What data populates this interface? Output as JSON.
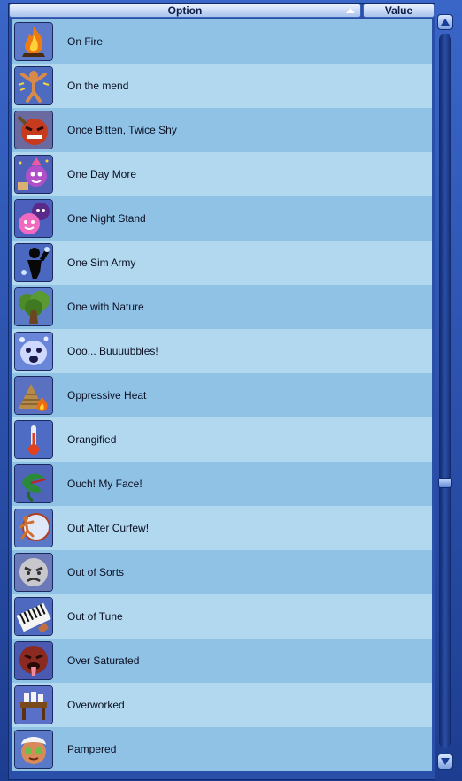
{
  "header": {
    "option_label": "Option",
    "value_label": "Value"
  },
  "rows": [
    {
      "label": "On Fire",
      "icon": "fire-icon"
    },
    {
      "label": "On the mend",
      "icon": "recovering-sim-icon"
    },
    {
      "label": "Once Bitten, Twice Shy",
      "icon": "angry-face-icon"
    },
    {
      "label": "One Day More",
      "icon": "party-face-icon"
    },
    {
      "label": "One Night Stand",
      "icon": "pink-faces-icon"
    },
    {
      "label": "One Sim Army",
      "icon": "silhouette-icon"
    },
    {
      "label": "One with Nature",
      "icon": "tree-icon"
    },
    {
      "label": "Ooo... Buuuubbles!",
      "icon": "bubble-face-icon"
    },
    {
      "label": "Oppressive Heat",
      "icon": "pyramid-fire-icon"
    },
    {
      "label": "Orangified",
      "icon": "thermometer-icon"
    },
    {
      "label": "Ouch! My Face!",
      "icon": "plant-monster-icon"
    },
    {
      "label": "Out After Curfew!",
      "icon": "clock-runner-icon"
    },
    {
      "label": "Out of Sorts",
      "icon": "grumpy-face-icon"
    },
    {
      "label": "Out of Tune",
      "icon": "keyboard-icon"
    },
    {
      "label": "Over Saturated",
      "icon": "tongue-face-icon"
    },
    {
      "label": "Overworked",
      "icon": "desk-icon"
    },
    {
      "label": "Pampered",
      "icon": "spa-face-icon"
    }
  ],
  "colors": {
    "row_odd": "#90c2e6",
    "row_even": "#b1d8ee",
    "panel": "#2a4fa8"
  }
}
